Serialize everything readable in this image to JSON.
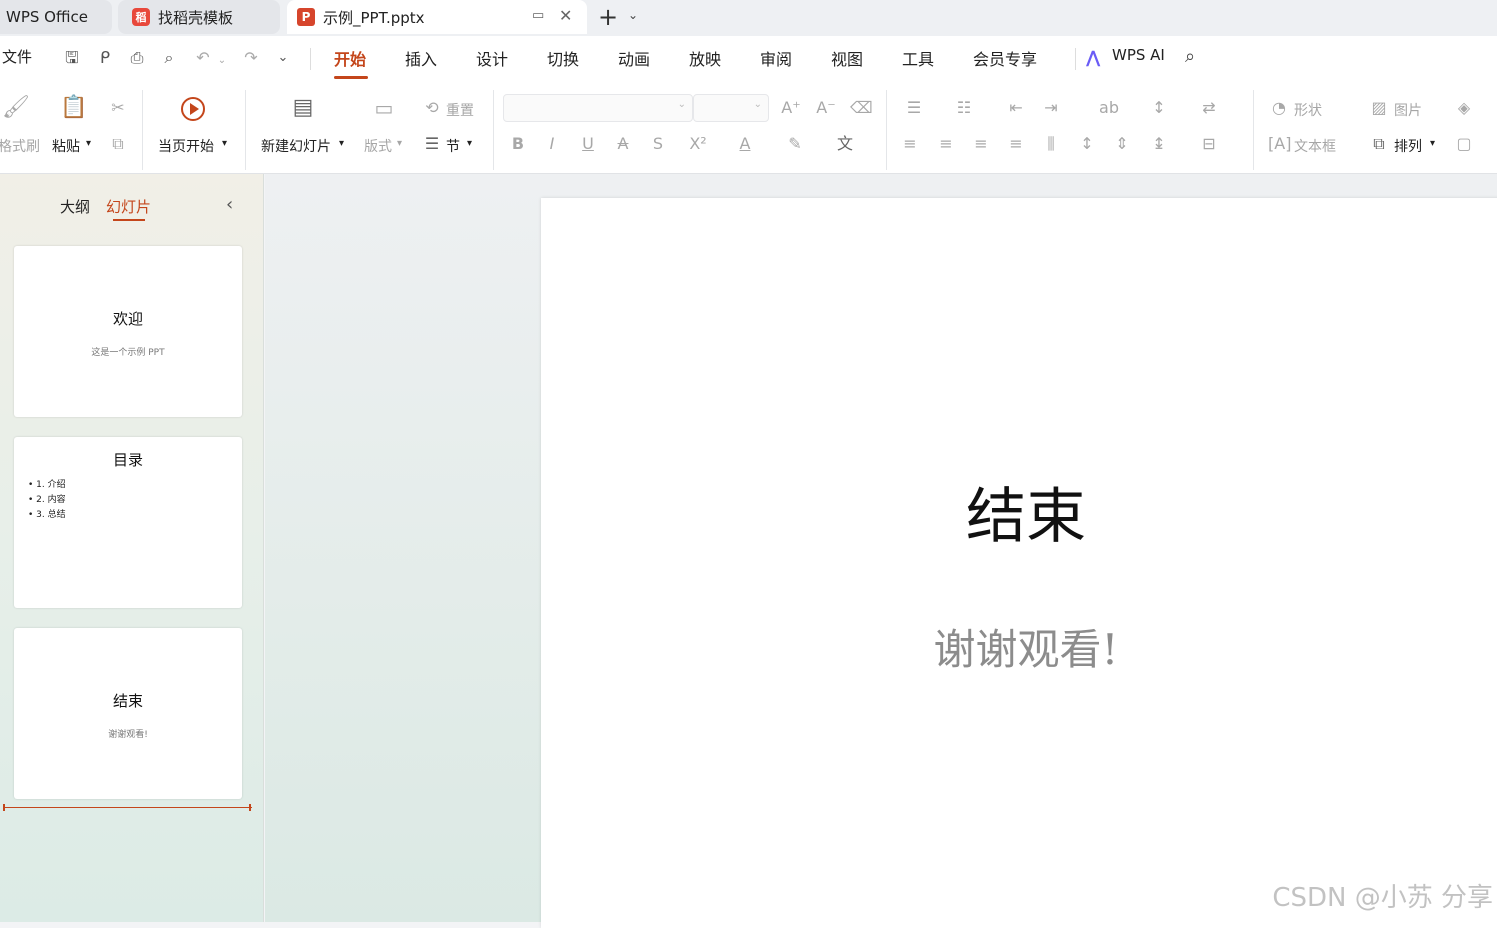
{
  "tabs": {
    "wps": "WPS Office",
    "template": "找稻壳模板",
    "doc": "示例_PPT.pptx",
    "doc_badge": "P",
    "template_badge": "稻",
    "new_tab": "+"
  },
  "menu": {
    "file": "文件",
    "items": [
      "开始",
      "插入",
      "设计",
      "切换",
      "动画",
      "放映",
      "审阅",
      "视图",
      "工具",
      "会员专享"
    ],
    "ai": "WPS AI"
  },
  "ribbon": {
    "format_painter": "格式刷",
    "paste": "粘贴",
    "play_from_current": "当页开始",
    "new_slide": "新建幻灯片",
    "layout": "版式",
    "reset": "重置",
    "section": "节",
    "shape": "形状",
    "picture": "图片",
    "textbox": "文本框",
    "arrange": "排列"
  },
  "panel": {
    "outline_tab": "大纲",
    "slides_tab": "幻灯片"
  },
  "thumbnails": [
    {
      "title": "欢迎",
      "subtitle": "这是一个示例 PPT"
    },
    {
      "title": "目录",
      "bullets": [
        "1. 介绍",
        "2. 内容",
        "3. 总结"
      ]
    },
    {
      "title": "结束",
      "subtitle": "谢谢观看!"
    }
  ],
  "slide": {
    "title": "结束",
    "subtitle": "谢谢观看!"
  },
  "watermark": "CSDN @小苏 分享",
  "colors": {
    "accent": "#c4461b",
    "ppt_logo": "#d6452c"
  }
}
